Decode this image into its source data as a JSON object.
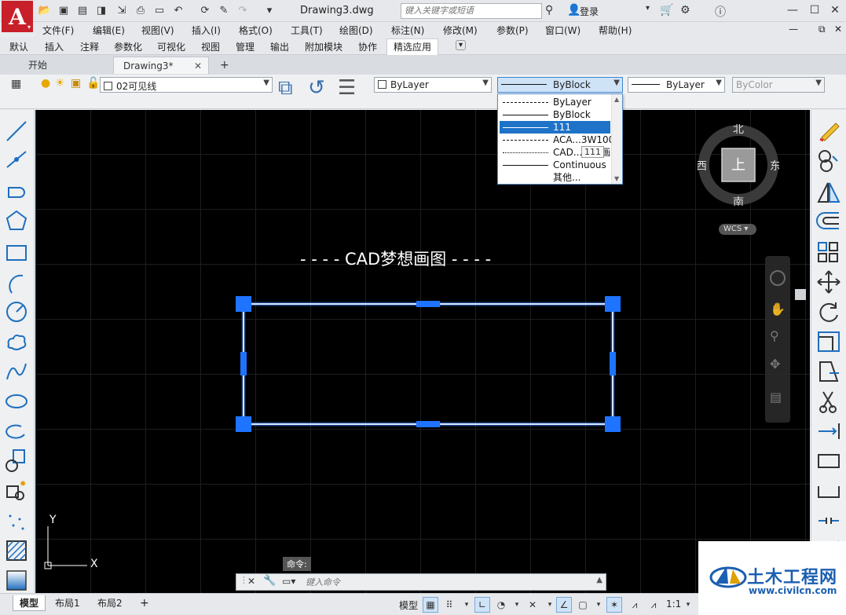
{
  "titlebar": {
    "app_logo": "A",
    "doc_title": "Drawing3.dwg",
    "search_placeholder": "键入关键字或短语",
    "login": "登录"
  },
  "menu": [
    "文件(F)",
    "编辑(E)",
    "视图(V)",
    "插入(I)",
    "格式(O)",
    "工具(T)",
    "绘图(D)",
    "标注(N)",
    "修改(M)",
    "参数(P)",
    "窗口(W)",
    "帮助(H)"
  ],
  "ribbon_tabs": [
    "默认",
    "插入",
    "注释",
    "参数化",
    "可视化",
    "视图",
    "管理",
    "输出",
    "附加模块",
    "协作",
    "精选应用"
  ],
  "ribbon_active": "精选应用",
  "file_tabs": {
    "start": "开始",
    "drawing": "Drawing3*",
    "add": "+"
  },
  "layer_combo": "02可见线",
  "color_combo": "ByLayer",
  "linetype_combo": "ByBlock",
  "lineweight_combo": "ByLayer",
  "plotstyle_combo": "ByColor",
  "linetype_dropdown": {
    "items": [
      {
        "name": "ByLayer",
        "style": "dashed",
        "highlighted": false
      },
      {
        "name": "ByBlock",
        "style": "solid",
        "highlighted": false
      },
      {
        "name": "111",
        "style": "text",
        "highlighted": true
      },
      {
        "name": "ACA...3W100",
        "style": "dashed",
        "highlighted": false
      },
      {
        "name": "CAD...梦想画",
        "style": "dashdot",
        "highlighted": false
      },
      {
        "name": "Continuous",
        "style": "solid",
        "highlighted": false
      },
      {
        "name": "其他...",
        "style": "none",
        "highlighted": false
      }
    ],
    "tooltip": "111"
  },
  "drawing_text": "- - - - CAD梦想画图 - - - -",
  "viewcube": {
    "north": "北",
    "south": "南",
    "east": "东",
    "west": "西",
    "top": "上",
    "wcs": "WCS"
  },
  "ucs": {
    "x": "X",
    "y": "Y"
  },
  "command": {
    "label": "命令:",
    "placeholder": "键入命令"
  },
  "layout_tabs": [
    "模型",
    "布局1",
    "布局2",
    "+"
  ],
  "status": {
    "model": "模型",
    "scale": "1:1"
  },
  "watermark": {
    "title": "土木工程网",
    "url": "www.civilcn.com"
  },
  "colors": {
    "accent": "#1e73c8",
    "grip": "#1e73ff",
    "canvas": "#000000",
    "logo": "#c8202a"
  }
}
